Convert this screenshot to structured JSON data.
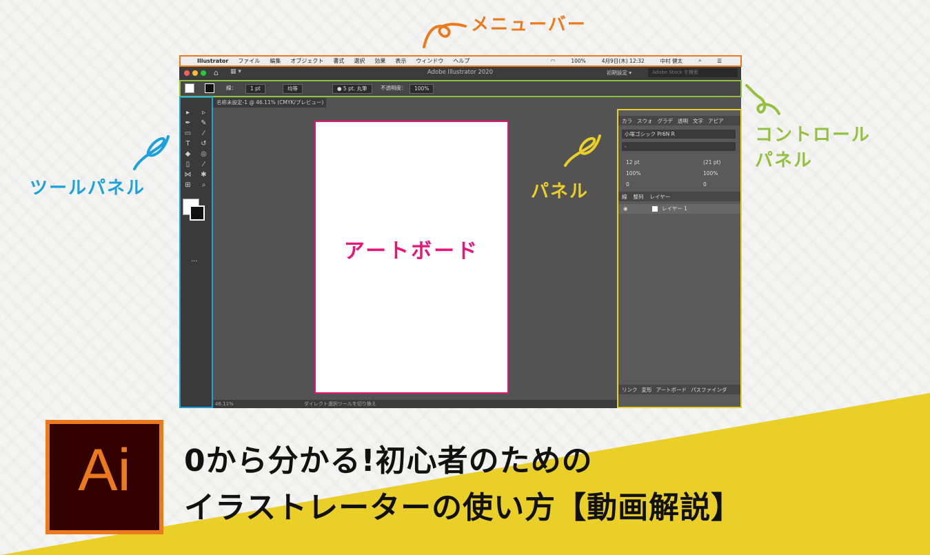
{
  "menubar": {
    "app": "Illustrator",
    "items": [
      "ファイル",
      "編集",
      "オブジェクト",
      "書式",
      "選択",
      "効果",
      "表示",
      "ウィンドウ",
      "ヘルプ"
    ],
    "status": [
      "100%",
      "4月9日(木) 12:32",
      "中村 健太"
    ]
  },
  "titlebar": {
    "title": "Adobe Illustrator 2020",
    "workspace": "初期設定 ▾",
    "search_placeholder": "Adobe Stock を検索"
  },
  "controlbar": {
    "stroke_label": "線：",
    "stroke_value": "1 pt",
    "line_style": "均等",
    "brush": "● 5 pt. 丸筆",
    "opacity_label": "不透明度：",
    "opacity_value": "100%"
  },
  "document_tab": "名称未設定-1 @ 46.11% (CMYK/プレビュー)",
  "artboard_label": "アートボード",
  "panel": {
    "tabs": [
      "カラ",
      "スウォ",
      "グラデ",
      "透明",
      "文字",
      "アピア"
    ],
    "font": "小塚ゴシック Pr6N R",
    "font_style": "-",
    "size": "12 pt",
    "leading": "(21 pt)",
    "vscale": "100%",
    "hscale": "100%",
    "tracking": "0",
    "kerning": "0",
    "layer_tabs": [
      "線",
      "整列",
      "レイヤー"
    ],
    "layer_name": "レイヤー 1",
    "bottom_tabs": [
      "リンク",
      "変形",
      "アートボード",
      "パスファインダ"
    ]
  },
  "status_bar": {
    "zoom": "46.11%",
    "tool": "ダイレクト選択ツールを切り換え"
  },
  "callouts": {
    "menu": "メニューバー",
    "control_1": "コントロール",
    "control_2": "パネル",
    "tool": "ツールパネル",
    "panel": "パネル"
  },
  "banner": {
    "icon_text": "Ai",
    "line1": "0から分かる!初心者のための",
    "line2": "イラストレーターの使い方【動画解説】"
  },
  "colors": {
    "menu_highlight": "#ec7a1c",
    "control_highlight": "#93c13e",
    "tool_highlight": "#1da1dc",
    "panel_highlight": "#e9cf28",
    "artboard_accent": "#e5157a",
    "banner_yellow": "#e9cf28"
  }
}
